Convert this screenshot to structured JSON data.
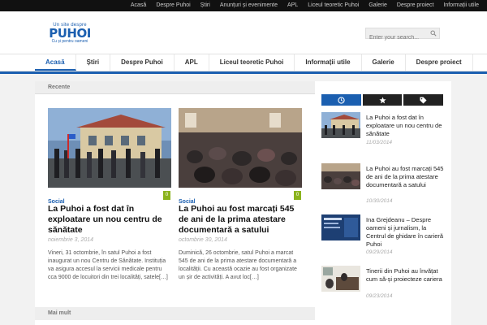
{
  "topnav": [
    "Acasă",
    "Despre Puhoi",
    "Știri",
    "Anunțuri și evenimente",
    "APL",
    "Liceul teoretic Puhoi",
    "Galerie",
    "Despre proiect",
    "Informații utile"
  ],
  "logo": {
    "tagline_top": "Un site despre",
    "brand": "PUHOI",
    "tagline_bottom": "Cu și pentru oameni"
  },
  "search": {
    "placeholder": "Enter your search..."
  },
  "mainnav": [
    {
      "label": "Acasă",
      "active": true
    },
    {
      "label": "Știri"
    },
    {
      "label": "Despre Puhoi"
    },
    {
      "label": "APL"
    },
    {
      "label": "Liceul teoretic Puhoi"
    },
    {
      "label": "Informații utile"
    },
    {
      "label": "Galerie"
    },
    {
      "label": "Despre proiect"
    }
  ],
  "recent": {
    "heading": "Recente",
    "posts": [
      {
        "category": "Social",
        "comments": "0",
        "title": "La Puhoi a fost dat în exploatare un nou centru de sănătate",
        "date": "noiembrie 3, 2014",
        "excerpt": "Vineri, 31 octombrie,  în satul Puhoi a fost inaugurat un nou Centru de Sănătate. Instituția va asigura accesul la servicii medicale pentru cca 9000 de locuitori din trei localități, satele[…]"
      },
      {
        "category": "Social",
        "comments": "0",
        "title": "La Puhoi au fost marcați 545 de ani de la prima atestare documentară a satului",
        "date": "octombrie 30, 2014",
        "excerpt": "Duminică, 26 octombrie, satul Puhoi a marcat 545 de ani de la prima atestare documentară a localității. Cu această ocazie au fost organizate un șir de activități. A avut loc[…]"
      }
    ]
  },
  "more": {
    "heading": "Mai mult"
  },
  "sidebar": {
    "tabs": [
      "clock-icon",
      "star-icon",
      "tags-icon"
    ],
    "items": [
      {
        "title": "La Puhoi a fost dat în exploatare un nou centru de sănătate",
        "date": "11/03/2014"
      },
      {
        "title": "La Puhoi au fost marcați 545 de ani de la prima atestare documentară a satului",
        "date": "10/30/2014"
      },
      {
        "title": "Ina Grejdeanu – Despre oameni și jurnalism, la Centrul de ghidare în carieră Puhoi",
        "date": "09/29/2014"
      },
      {
        "title": "Tinerii din Puhoi au învățat cum să-și proiecteze cariera",
        "date": "09/23/2014"
      }
    ]
  },
  "colors": {
    "accent": "#1b5fb0",
    "comment_badge": "#8bb31e",
    "topbar": "#111111"
  }
}
